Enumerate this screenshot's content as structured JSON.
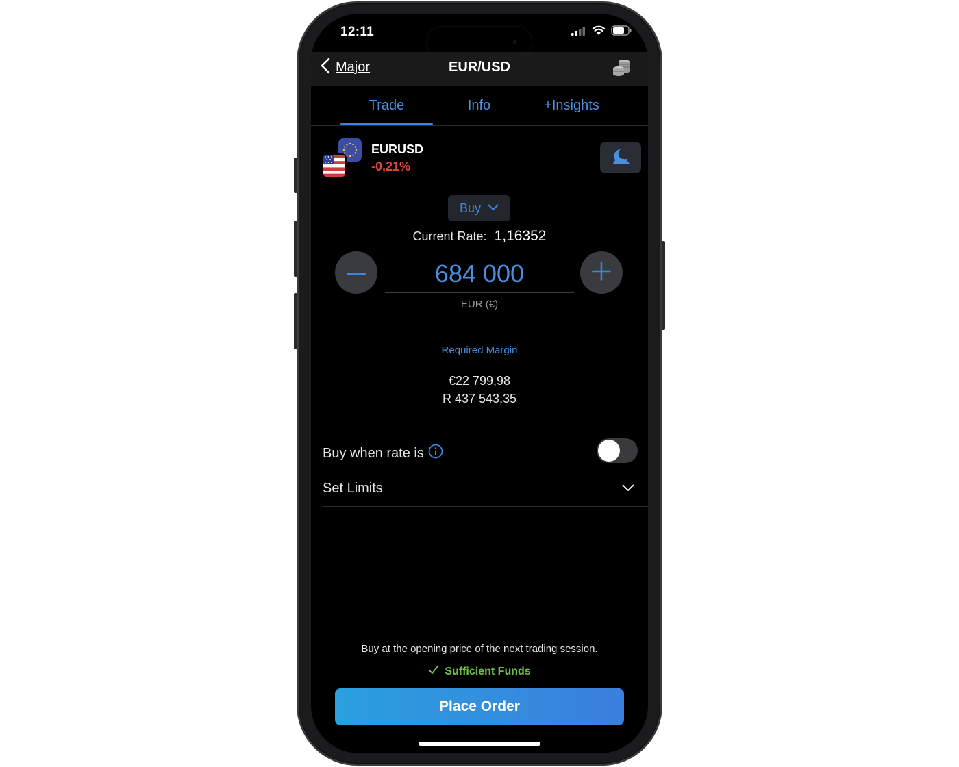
{
  "status_bar": {
    "time": "12:11"
  },
  "nav": {
    "back_label": "Major",
    "title": "EUR/USD"
  },
  "tabs": [
    {
      "label": "Trade",
      "active": true
    },
    {
      "label": "Info",
      "active": false
    },
    {
      "label": "+Insights",
      "active": false
    }
  ],
  "instrument": {
    "symbol": "EURUSD",
    "change": "-0,21%"
  },
  "order": {
    "direction": "Buy",
    "rate_label": "Current Rate:",
    "rate_value": "1,16352",
    "amount": "684 000",
    "currency": "EUR (€)"
  },
  "margin": {
    "label": "Required Margin",
    "eur": "€22 799,98",
    "zar": "R 437 543,35"
  },
  "options": {
    "buy_when_label": "Buy when rate is",
    "buy_when_enabled": false,
    "set_limits_label": "Set Limits"
  },
  "footer": {
    "info": "Buy at the opening price of the next trading session.",
    "funds": "Sufficient Funds",
    "place_order": "Place Order"
  },
  "colors": {
    "accent": "#3b86e0",
    "negative": "#e0453c",
    "positive": "#6fbf4a",
    "background": "#000000"
  }
}
